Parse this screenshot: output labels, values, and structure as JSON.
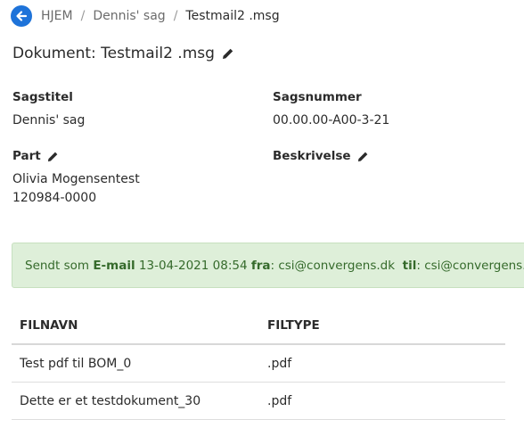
{
  "breadcrumb": {
    "items": [
      "HJEM",
      "Dennis' sag",
      "Testmail2 .msg"
    ],
    "separator": "/"
  },
  "page_title": "Dokument: Testmail2 .msg",
  "fields": {
    "sagstitel_label": "Sagstitel",
    "sagstitel_value": "Dennis' sag",
    "sagsnummer_label": "Sagsnummer",
    "sagsnummer_value": "00.00.00-A00-3-21",
    "part_label": "Part",
    "part_name": "Olivia Mogensentest",
    "part_id": "120984-0000",
    "beskrivelse_label": "Beskrivelse"
  },
  "alert": {
    "prefix": "Sendt som",
    "type": "E-mail",
    "datetime": "13-04-2021 08:54",
    "from_label": "fra",
    "from": "csi@convergens.dk",
    "to_label": "til",
    "to": "csi@convergens.dk"
  },
  "table": {
    "headers": [
      "FILNAVN",
      "FILTYPE"
    ],
    "rows": [
      [
        "Test pdf til BOM_0",
        ".pdf"
      ],
      [
        "Dette er et testdokument_30",
        ".pdf"
      ]
    ]
  },
  "colors": {
    "accent": "#1e73d9",
    "alert_bg": "#deefd9",
    "alert_text": "#356a2b"
  },
  "icons": [
    "arrow-left-icon",
    "pencil-icon"
  ]
}
